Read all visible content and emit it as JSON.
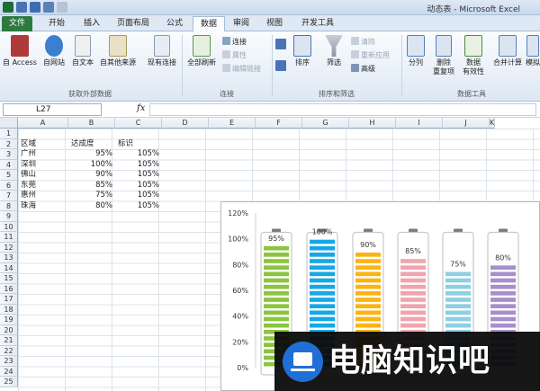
{
  "window": {
    "title": "动态表 - Microsoft Excel"
  },
  "ribbon_tabs": [
    "文件",
    "开始",
    "插入",
    "页面布局",
    "公式",
    "数据",
    "审阅",
    "视图",
    "开发工具"
  ],
  "active_tab": "数据",
  "ribbon": {
    "get_external": {
      "access": "自 Access",
      "web": "自网站",
      "text": "自文本",
      "other": "自其他来源",
      "existing": "现有连接",
      "group": "获取外部数据"
    },
    "connections": {
      "refresh": "全部刷新",
      "connections": "连接",
      "properties": "属性",
      "edit_links": "编辑链接",
      "group": "连接"
    },
    "sort_filter": {
      "sort": "排序",
      "filter": "筛选",
      "clear": "清除",
      "reapply": "重新应用",
      "advanced": "高级",
      "group": "排序和筛选"
    },
    "data_tools": {
      "split": "分列",
      "remove_dup_1": "删除",
      "remove_dup_2": "重复项",
      "validation_1": "数据",
      "validation_2": "有效性",
      "consolidate": "合并计算",
      "whatif": "模拟",
      "group": "数据工具"
    }
  },
  "name_box": "L27",
  "fx_symbol": "fx",
  "columns": [
    "A",
    "B",
    "C",
    "D",
    "E",
    "F",
    "G",
    "H",
    "I",
    "J",
    "K"
  ],
  "rows": [
    "1",
    "2",
    "3",
    "4",
    "5",
    "6",
    "7",
    "8",
    "9",
    "10",
    "11",
    "12",
    "13",
    "14",
    "15",
    "16",
    "17",
    "18",
    "19",
    "20",
    "21",
    "22",
    "23",
    "24",
    "25"
  ],
  "table": {
    "headers": [
      "区域",
      "达成度",
      "标识"
    ],
    "rows": [
      [
        "广州",
        "95%",
        "105%"
      ],
      [
        "深圳",
        "100%",
        "105%"
      ],
      [
        "佛山",
        "90%",
        "105%"
      ],
      [
        "东莞",
        "85%",
        "105%"
      ],
      [
        "惠州",
        "75%",
        "105%"
      ],
      [
        "珠海",
        "80%",
        "105%"
      ]
    ]
  },
  "chart_data": {
    "type": "bar",
    "categories": [
      "广州",
      "深圳",
      "佛山",
      "东莞",
      "惠州",
      "珠海"
    ],
    "series": [
      {
        "values": [
          0.95,
          1.0,
          0.9,
          0.85,
          0.75,
          0.8
        ]
      },
      {
        "values": [
          1.05,
          1.05,
          1.05,
          1.05,
          1.05,
          1.05
        ]
      }
    ],
    "data_labels": [
      "95%",
      "100%",
      "90%",
      "85%",
      "75%",
      "80%"
    ],
    "colors": [
      "#8bc53f",
      "#16a8e6",
      "#fbb412",
      "#f0a5ad",
      "#8dcfe3",
      "#a88ecb"
    ],
    "y_ticks": [
      "0%",
      "20%",
      "40%",
      "60%",
      "80%",
      "100%",
      "120%"
    ],
    "ylim": [
      0,
      1.2
    ]
  },
  "watermark": {
    "text": "电脑知识吧"
  }
}
